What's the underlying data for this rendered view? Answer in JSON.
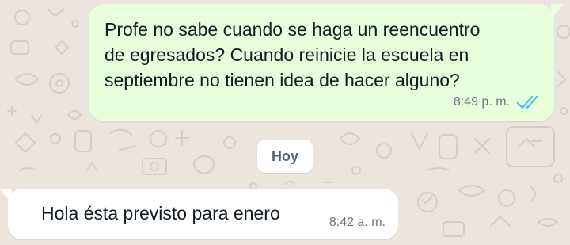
{
  "colors": {
    "chat_background": "#ECE5DD",
    "outgoing_bubble": "#E7FFDB",
    "incoming_bubble": "#FFFFFF",
    "read_ticks": "#53BDEB",
    "timestamp": "#667781",
    "message_text": "#111B21"
  },
  "messages": [
    {
      "direction": "outgoing",
      "text": "Profe no sabe cuando se haga un reencuentro\nde egresados? Cuando reinicie la escuela en\nseptiembre no tienen idea de hacer alguno?",
      "time": "8:49 p. m.",
      "status_icon": "double-check-read-icon"
    },
    {
      "direction": "incoming",
      "text": "Hola ésta previsto para enero",
      "time": "8:42 a. m."
    }
  ],
  "date_divider": {
    "label": "Hoy"
  }
}
